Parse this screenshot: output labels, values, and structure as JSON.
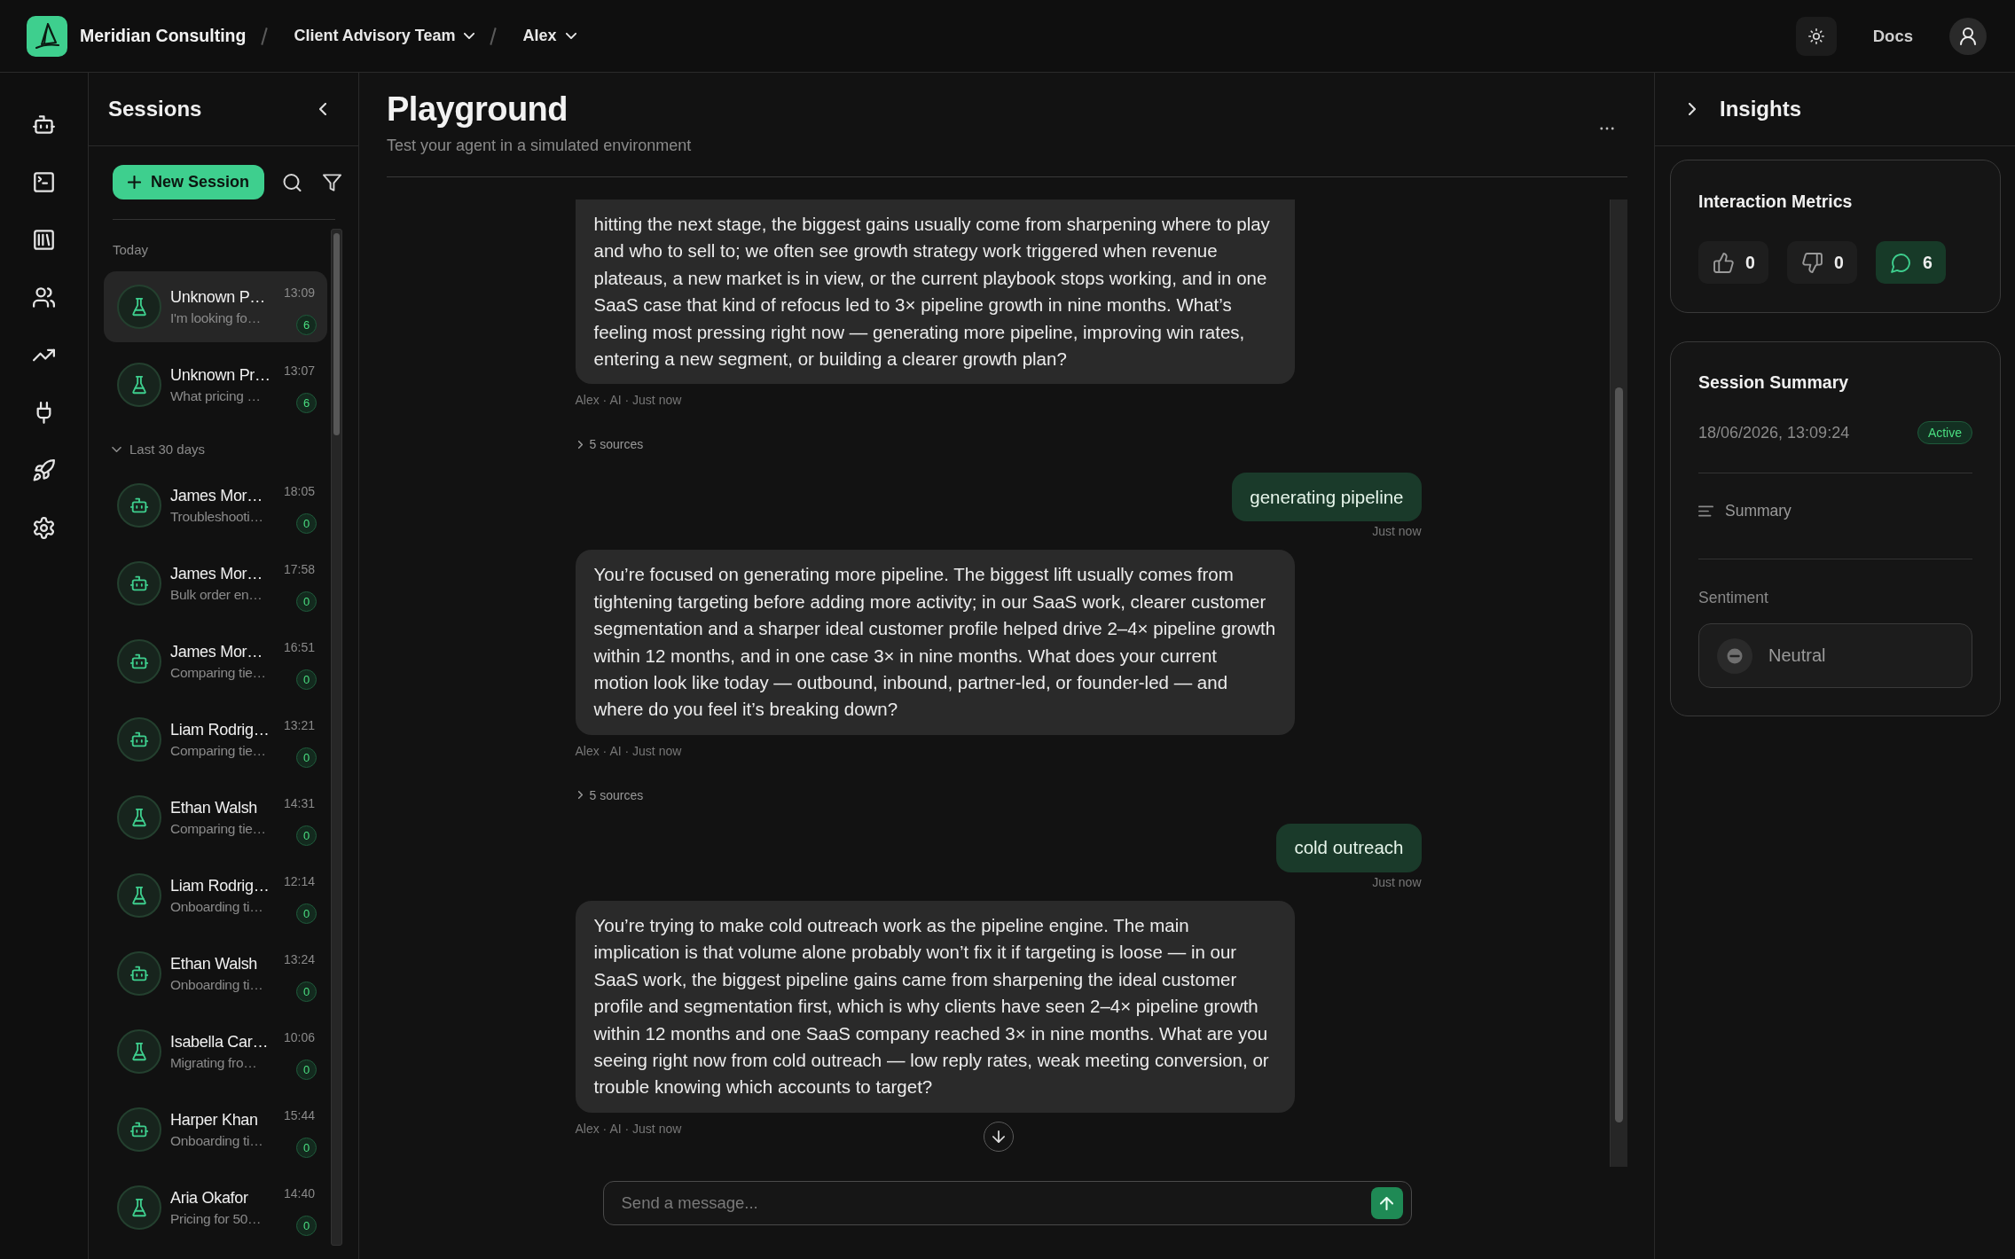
{
  "top_bar": {
    "brand": "Meridian Consulting",
    "breadcrumbs": [
      {
        "label": "Client Advisory Team"
      },
      {
        "label": "Alex"
      }
    ],
    "docs_link": "Docs"
  },
  "sessions_panel": {
    "title": "Sessions",
    "new_session_button": "New Session",
    "groups": [
      {
        "label": "Today",
        "collapsible": false,
        "sessions": [
          {
            "kind": "test",
            "name": "Unknown P…",
            "preview": "I'm looking fo…",
            "time": "13:09",
            "count": "6",
            "selected": true
          },
          {
            "kind": "test",
            "name": "Unknown Pr…",
            "preview": "What pricing …",
            "time": "13:07",
            "count": "6",
            "selected": false
          }
        ]
      },
      {
        "label": "Last 30 days",
        "collapsible": true,
        "expanded": true,
        "sessions": [
          {
            "kind": "agent",
            "name": "James Mor…",
            "preview": "Troubleshooti…",
            "time": "18:05",
            "count": "0",
            "selected": false
          },
          {
            "kind": "agent",
            "name": "James Mor…",
            "preview": "Bulk order en…",
            "time": "17:58",
            "count": "0",
            "selected": false
          },
          {
            "kind": "agent",
            "name": "James Mor…",
            "preview": "Comparing tie…",
            "time": "16:51",
            "count": "0",
            "selected": false
          },
          {
            "kind": "agent",
            "name": "Liam Rodrig…",
            "preview": "Comparing tie…",
            "time": "13:21",
            "count": "0",
            "selected": false
          },
          {
            "kind": "test",
            "name": "Ethan Walsh",
            "preview": "Comparing tie…",
            "time": "14:31",
            "count": "0",
            "selected": false
          },
          {
            "kind": "test",
            "name": "Liam Rodrig…",
            "preview": "Onboarding ti…",
            "time": "12:14",
            "count": "0",
            "selected": false
          },
          {
            "kind": "agent",
            "name": "Ethan Walsh",
            "preview": "Onboarding ti…",
            "time": "13:24",
            "count": "0",
            "selected": false
          },
          {
            "kind": "test",
            "name": "Isabella Car…",
            "preview": "Migrating fro…",
            "time": "10:06",
            "count": "0",
            "selected": false
          },
          {
            "kind": "agent",
            "name": "Harper Khan",
            "preview": "Onboarding ti…",
            "time": "15:44",
            "count": "0",
            "selected": false
          },
          {
            "kind": "test",
            "name": "Aria Okafor",
            "preview": "Pricing for 50…",
            "time": "14:40",
            "count": "0",
            "selected": false
          }
        ]
      }
    ]
  },
  "playground": {
    "title": "Playground",
    "subtitle": "Test your agent in a simulated environment",
    "messages": [
      {
        "kind": "assistant",
        "text": "hitting the next stage, the biggest gains usually come from sharpening where to play and who to sell to; we often see growth strategy work triggered when revenue plateaus, a new market is in view, or the current playbook stops working, and in one SaaS case that kind of refocus led to 3× pipeline growth in nine months. What’s feeling most pressing right now — generating more pipeline, improving win rates, entering a new segment, or building a clearer growth plan?",
        "meta": "Alex · AI · Just now",
        "sources": {
          "label": "5 sources",
          "expanded": false
        }
      },
      {
        "kind": "user",
        "text": "generating pipeline",
        "meta": "Just now"
      },
      {
        "kind": "assistant",
        "text": "You’re focused on generating more pipeline. The biggest lift usually comes from tightening targeting before adding more activity; in our SaaS work, clearer customer segmentation and a sharper ideal customer profile helped drive 2–4× pipeline growth within 12 months, and in one case 3× in nine months. What does your current motion look like today — outbound, inbound, partner-led, or founder-led — and where do you feel it’s breaking down?",
        "meta": "Alex · AI · Just now",
        "sources": {
          "label": "5 sources",
          "expanded": false
        }
      },
      {
        "kind": "user",
        "text": "cold outreach",
        "meta": "Just now"
      },
      {
        "kind": "assistant",
        "text": "You’re trying to make cold outreach work as the pipeline engine. The main implication is that volume alone probably won’t fix it if targeting is loose — in our SaaS work, the biggest pipeline gains came from sharpening the ideal customer profile and segmentation first, which is why clients have seen 2–4× pipeline growth within 12 months and one SaaS company reached 3× in nine months. What are you seeing right now from cold outreach — low reply rates, weak meeting conversion, or trouble knowing which accounts to target?",
        "meta": "Alex · AI · Just now"
      }
    ],
    "composer": {
      "placeholder": "Send a message..."
    }
  },
  "insights": {
    "title": "Insights",
    "metrics_card": {
      "title": "Interaction Metrics",
      "metrics": [
        {
          "kind": "thumbs_up",
          "value": "0",
          "active": false
        },
        {
          "kind": "thumbs_down",
          "value": "0",
          "active": false
        },
        {
          "kind": "comments",
          "value": "6",
          "active": true
        }
      ]
    },
    "summary_card": {
      "title": "Session Summary",
      "timestamp": "18/06/2026, 13:09:24",
      "status": "Active",
      "summary_label": "Summary",
      "sentiment_label": "Sentiment",
      "sentiment": "Neutral"
    }
  }
}
